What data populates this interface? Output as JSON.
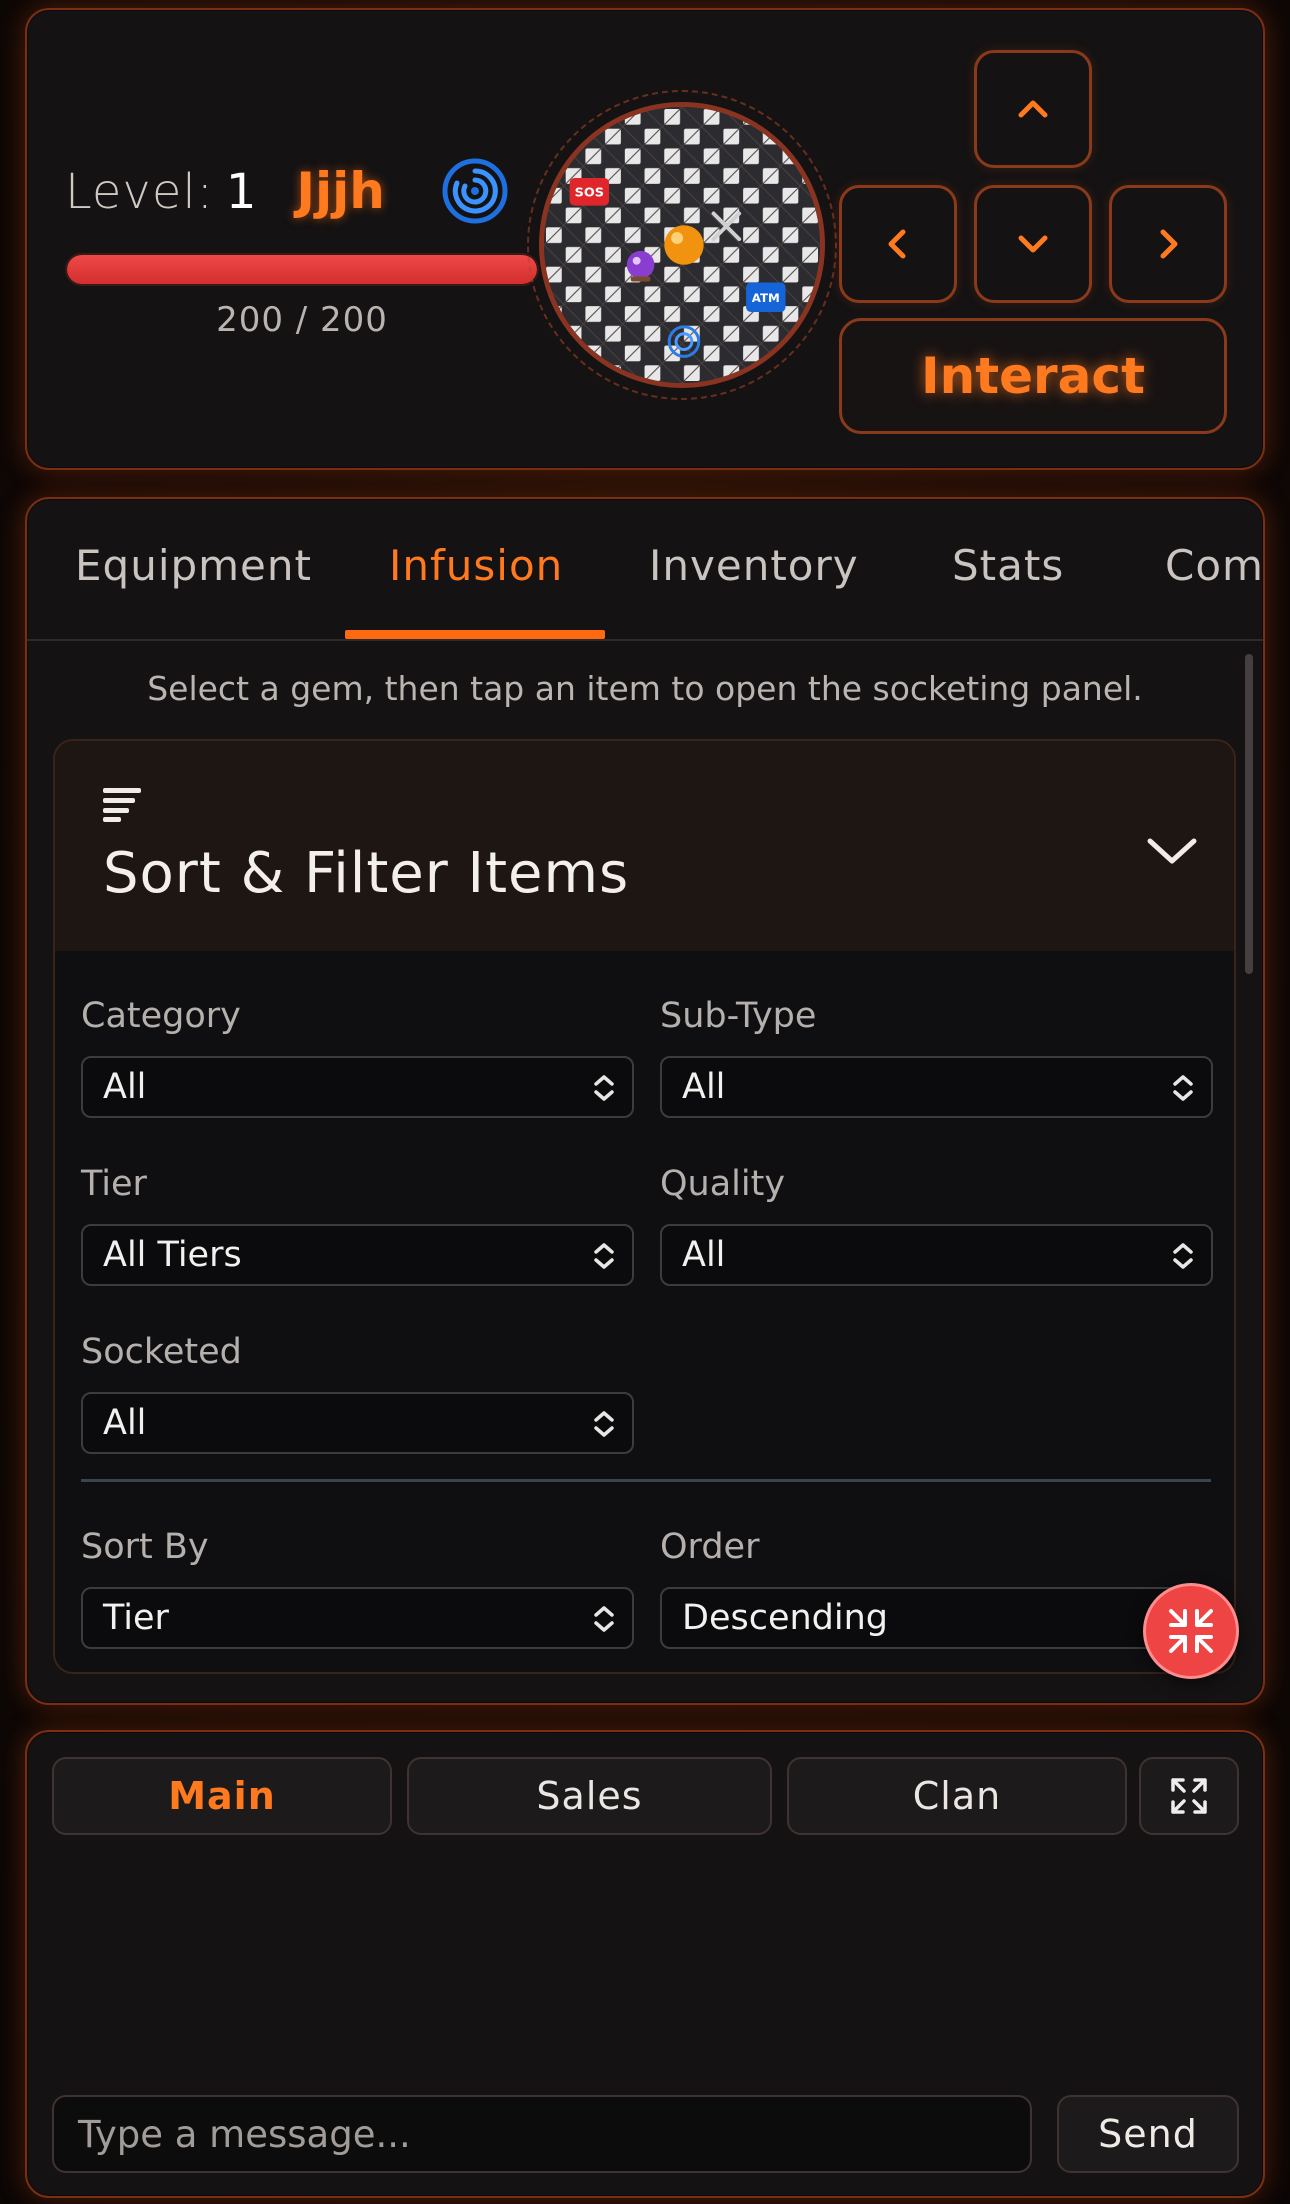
{
  "hud": {
    "level_label": "Level:",
    "level_value": "1",
    "player_name": "Jjjh",
    "status_icon": "cyclone-icon",
    "hp_text": "200 / 200",
    "hp_fraction": 1.0,
    "minimap": {
      "items": [
        "SOS",
        "ATM"
      ],
      "icons": [
        "sos-icon",
        "crossed-swords-icon",
        "player-orb-icon",
        "crystal-ball-icon",
        "atm-icon",
        "cyclone-icon"
      ]
    },
    "controls": {
      "up": "chevron-up-icon",
      "left": "chevron-left-icon",
      "down": "chevron-down-icon",
      "right": "chevron-right-icon",
      "interact_label": "Interact"
    }
  },
  "tabs": [
    {
      "label": "Equipment",
      "active": false
    },
    {
      "label": "Infusion",
      "active": true
    },
    {
      "label": "Inventory",
      "active": false
    },
    {
      "label": "Stats",
      "active": false
    },
    {
      "label": "Comb",
      "active": false
    }
  ],
  "hint": "Select a gem, then tap an item to open the socketing panel.",
  "filter": {
    "title": "Sort & Filter Items",
    "category": {
      "label": "Category",
      "value": "All"
    },
    "subtype": {
      "label": "Sub-Type",
      "value": "All"
    },
    "tier": {
      "label": "Tier",
      "value": "All Tiers"
    },
    "quality": {
      "label": "Quality",
      "value": "All"
    },
    "socketed": {
      "label": "Socketed",
      "value": "All"
    },
    "sort_by": {
      "label": "Sort By",
      "value": "Tier"
    },
    "order": {
      "label": "Order",
      "value": "Descending"
    }
  },
  "chat": {
    "tabs": [
      {
        "label": "Main",
        "active": true
      },
      {
        "label": "Sales",
        "active": false
      },
      {
        "label": "Clan",
        "active": false
      }
    ],
    "placeholder": "Type a message...",
    "send_label": "Send"
  },
  "colors": {
    "accent": "#ff7a1f",
    "panel_border": "#7a2e14",
    "hp": "#e53935",
    "fab": "#ef4444"
  }
}
